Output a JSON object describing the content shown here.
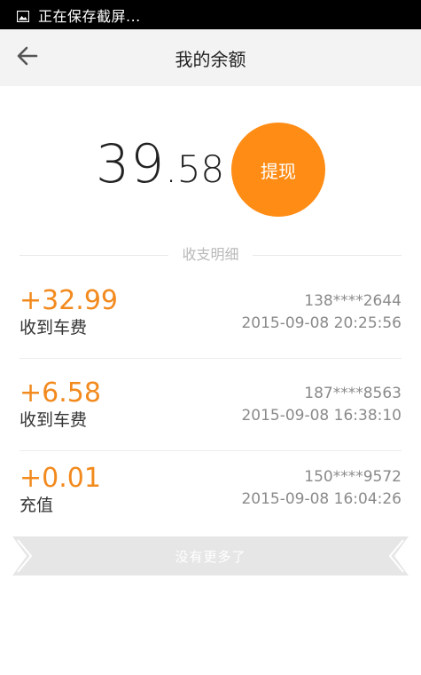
{
  "status_bar": {
    "text": "正在保存截屏...",
    "icon": "image-icon"
  },
  "header": {
    "title": "我的余额",
    "back_icon": "arrow-left-icon"
  },
  "balance": {
    "integer_part": "39",
    "decimal_part": ".58"
  },
  "withdraw_button": {
    "label": "提现",
    "color": "#ff8c14"
  },
  "section_label": "收支明细",
  "transactions": [
    {
      "amount": "+32.99",
      "type": "收到车费",
      "phone": "138****2644",
      "time": "2015-09-08 20:25:56"
    },
    {
      "amount": "+6.58",
      "type": "收到车费",
      "phone": "187****8563",
      "time": "2015-09-08 16:38:10"
    },
    {
      "amount": "+0.01",
      "type": "充值",
      "phone": "150****9572",
      "time": "2015-09-08 16:04:26"
    }
  ],
  "no_more": "没有更多了",
  "colors": {
    "accent": "#ff8c14",
    "amount": "#f28a1e",
    "title_bar": "#f3f3f3",
    "no_more_bar": "#e6e6e6"
  }
}
